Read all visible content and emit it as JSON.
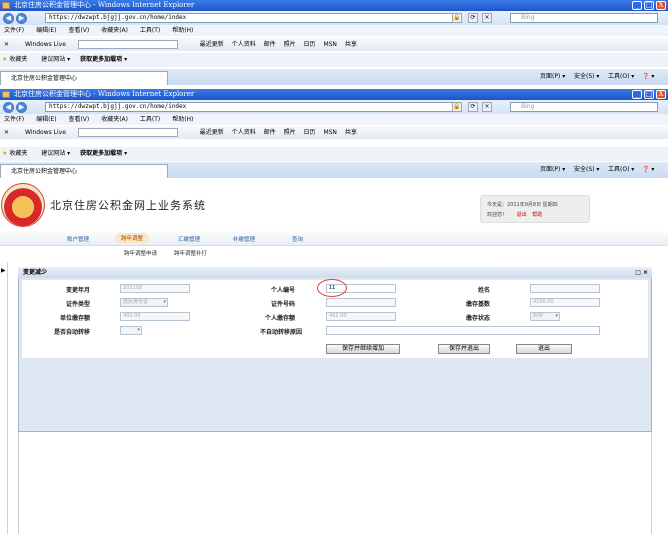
{
  "window": {
    "title": "北京住房公积金管理中心 - Windows Internet Explorer",
    "min": "_",
    "max": "□",
    "close": "X"
  },
  "address": {
    "url": "https://dwzwpt.bjgjj.gov.cn/home/index",
    "search_placeholder": "Bing"
  },
  "menu": [
    "文件(F)",
    "编辑(E)",
    "查看(V)",
    "收藏夹(A)",
    "工具(T)",
    "帮助(H)"
  ],
  "wl": {
    "brand": "Windows Live",
    "items": [
      "最近更新",
      "个人资料",
      "邮件",
      "照片",
      "日历",
      "MSN",
      "共享"
    ]
  },
  "fav": {
    "label": "收藏夹",
    "suggest": "建议网站 ▾",
    "more": "获取更多加载项 ▾"
  },
  "tab": {
    "label": "北京住房公积金管理中心"
  },
  "cmd": {
    "page": "页面(P) ▾",
    "safety": "安全(S) ▾",
    "tools": "工具(O) ▾",
    "help": "❓ ▾"
  },
  "app": {
    "title": "北京住房公积金网上业务系统",
    "user_line1": "今天是：2011年9月8日 星期四",
    "user_line2": "欢迎您！",
    "logout": "退出",
    "help": "帮助"
  },
  "nav": [
    "账户管理",
    "跨年调整",
    "汇缴管理",
    "补缴管理",
    "查询"
  ],
  "subnav": [
    "跨年调整申请",
    "跨年调整补打"
  ],
  "panel": {
    "title": "变更减少",
    "controls": "□ ×"
  },
  "form": {
    "r1": {
      "l1": "变更年月",
      "v1": "201108",
      "l2": "个人编号",
      "v2": "11",
      "l3": "姓名",
      "v3": ""
    },
    "r2": {
      "l1": "证件类型",
      "v1": "居民身份证",
      "l2": "证件号码",
      "v2": "",
      "l3": "缴存基数",
      "v3": "4100.00"
    },
    "r3": {
      "l1": "单位缴存额",
      "v1": "492.00",
      "l2": "个人缴存额",
      "v2": "492.00",
      "l3": "缴存状态",
      "v3": "封存"
    },
    "r4": {
      "l1": "是否自动转移",
      "v1": "",
      "l2": "不自动转移原因",
      "v2": ""
    }
  },
  "buttons": {
    "save_continue": "保存并继续增加",
    "save_exit": "保存并退出",
    "exit": "退出"
  },
  "top_window": {
    "addr": "https://dwzwpt.bjgjj.gov.cn/home/index",
    "cmd_page": "页面(P) ▾",
    "cmd_safety": "安全(S) ▾",
    "cmd_tools": "工具(O) ▾",
    "cmd_help": "❓ ▾"
  }
}
